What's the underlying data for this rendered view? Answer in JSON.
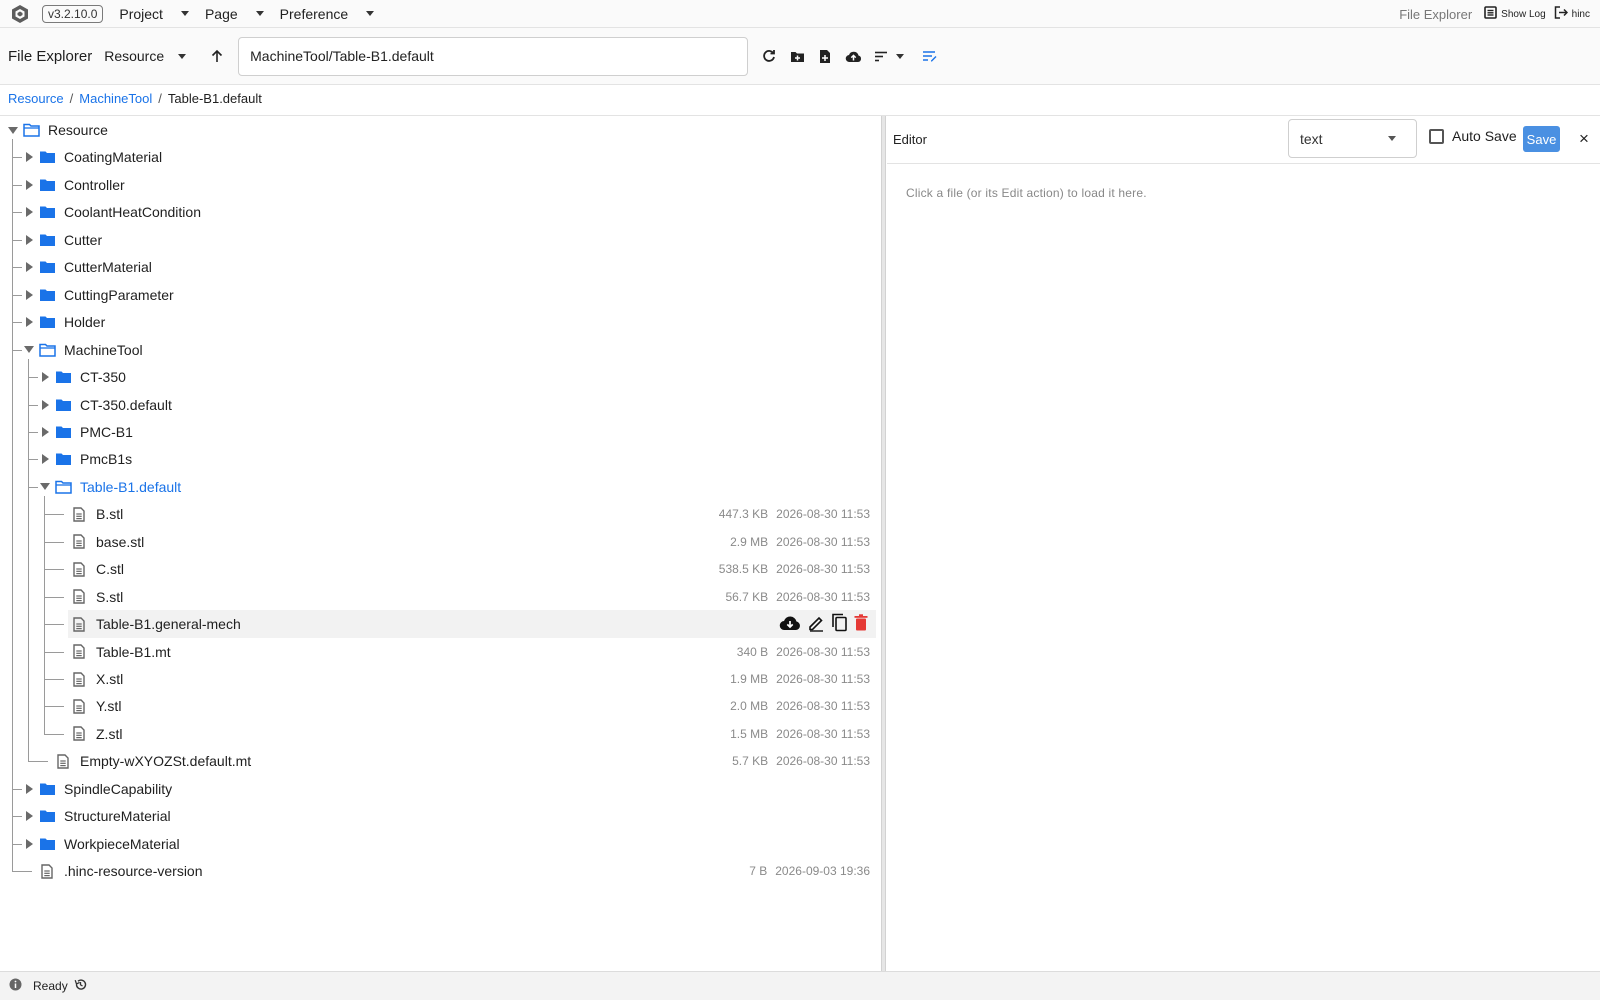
{
  "app": {
    "version": "v3.2.10.0",
    "menus": [
      {
        "label": "Project"
      },
      {
        "label": "Page"
      },
      {
        "label": "Preference"
      }
    ],
    "current_view": "File Explorer",
    "show_log_label": "Show Log",
    "user_label": "hinc"
  },
  "toolbar": {
    "title": "File Explorer",
    "root_select": "Resource",
    "path_value": "MachineTool/Table-B1.default"
  },
  "breadcrumb": {
    "items": [
      "Resource",
      "MachineTool"
    ],
    "current": "Table-B1.default",
    "separator": "/"
  },
  "tree": {
    "rows": [
      {
        "label": "Resource",
        "type": "folder",
        "depth": 0,
        "expanded": true
      },
      {
        "label": "CoatingMaterial",
        "type": "folder",
        "depth": 1,
        "expanded": false
      },
      {
        "label": "Controller",
        "type": "folder",
        "depth": 1,
        "expanded": false
      },
      {
        "label": "CoolantHeatCondition",
        "type": "folder",
        "depth": 1,
        "expanded": false
      },
      {
        "label": "Cutter",
        "type": "folder",
        "depth": 1,
        "expanded": false
      },
      {
        "label": "CutterMaterial",
        "type": "folder",
        "depth": 1,
        "expanded": false
      },
      {
        "label": "CuttingParameter",
        "type": "folder",
        "depth": 1,
        "expanded": false
      },
      {
        "label": "Holder",
        "type": "folder",
        "depth": 1,
        "expanded": false
      },
      {
        "label": "MachineTool",
        "type": "folder",
        "depth": 1,
        "expanded": true
      },
      {
        "label": "CT-350",
        "type": "folder",
        "depth": 2,
        "expanded": false
      },
      {
        "label": "CT-350.default",
        "type": "folder",
        "depth": 2,
        "expanded": false
      },
      {
        "label": "PMC-B1",
        "type": "folder",
        "depth": 2,
        "expanded": false
      },
      {
        "label": "PmcB1s",
        "type": "folder",
        "depth": 2,
        "expanded": false
      },
      {
        "label": "Table-B1.default",
        "type": "folder",
        "depth": 2,
        "expanded": true,
        "selected": true
      },
      {
        "label": "B.stl",
        "type": "file",
        "depth": 3,
        "size": "447.3 KB",
        "date": "2026-08-30 11:53"
      },
      {
        "label": "base.stl",
        "type": "file",
        "depth": 3,
        "size": "2.9 MB",
        "date": "2026-08-30 11:53"
      },
      {
        "label": "C.stl",
        "type": "file",
        "depth": 3,
        "size": "538.5 KB",
        "date": "2026-08-30 11:53"
      },
      {
        "label": "S.stl",
        "type": "file",
        "depth": 3,
        "size": "56.7 KB",
        "date": "2026-08-30 11:53"
      },
      {
        "label": "Table-B1.general-mech",
        "type": "file",
        "depth": 3,
        "hover": true
      },
      {
        "label": "Table-B1.mt",
        "type": "file",
        "depth": 3,
        "size": "340 B",
        "date": "2026-08-30 11:53"
      },
      {
        "label": "X.stl",
        "type": "file",
        "depth": 3,
        "size": "1.9 MB",
        "date": "2026-08-30 11:53"
      },
      {
        "label": "Y.stl",
        "type": "file",
        "depth": 3,
        "size": "2.0 MB",
        "date": "2026-08-30 11:53"
      },
      {
        "label": "Z.stl",
        "type": "file",
        "depth": 3,
        "size": "1.5 MB",
        "date": "2026-08-30 11:53"
      },
      {
        "label": "Empty-wXYOZSt.default.mt",
        "type": "file",
        "depth": 2,
        "size": "5.7 KB",
        "date": "2026-08-30 11:53"
      },
      {
        "label": "SpindleCapability",
        "type": "folder",
        "depth": 1,
        "expanded": false
      },
      {
        "label": "StructureMaterial",
        "type": "folder",
        "depth": 1,
        "expanded": false
      },
      {
        "label": "WorkpieceMaterial",
        "type": "folder",
        "depth": 1,
        "expanded": false
      },
      {
        "label": ".hinc-resource-version",
        "type": "file",
        "depth": 1,
        "size": "7 B",
        "date": "2026-09-03 19:36"
      }
    ],
    "row_actions": [
      "download-icon",
      "edit-icon",
      "copy-icon",
      "delete-icon"
    ]
  },
  "editor": {
    "title": "Editor",
    "mode": "text",
    "auto_save_label": "Auto Save",
    "auto_save_checked": false,
    "save_label": "Save",
    "close_label": "×",
    "hint": "Click a file (or its Edit action) to load it here."
  },
  "status": {
    "text": "Ready"
  },
  "colors": {
    "accent": "#1a73e8",
    "folder": "#1a73e8",
    "delete": "#e53935",
    "save_button": "#4a90e2"
  }
}
